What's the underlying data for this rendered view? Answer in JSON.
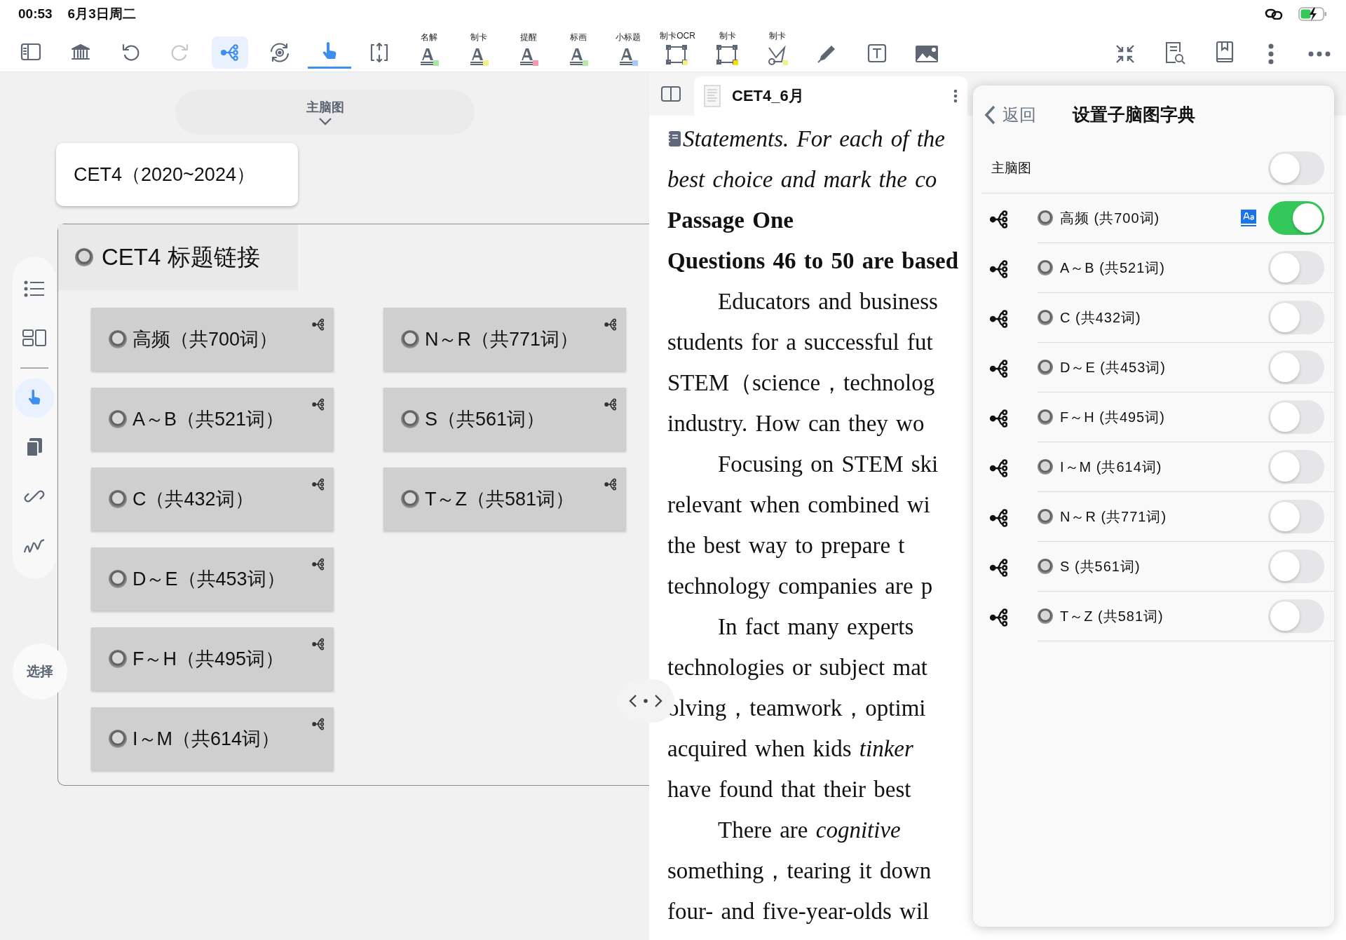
{
  "status_bar": {
    "time": "00:53",
    "date": "6月3日周二"
  },
  "toolbar": {
    "tools": [
      {
        "selected": false,
        "highlighted": false,
        "disabled": false
      },
      {
        "selected": false,
        "highlighted": false,
        "disabled": false
      },
      {
        "selected": false,
        "highlighted": false,
        "disabled": false
      },
      {
        "selected": false,
        "highlighted": false,
        "disabled": true
      },
      {
        "selected": false,
        "highlighted": true,
        "disabled": false
      },
      {
        "selected": false,
        "highlighted": false,
        "disabled": false
      },
      {
        "selected": true,
        "highlighted": false,
        "disabled": false
      },
      {
        "selected": false,
        "highlighted": false,
        "disabled": false
      }
    ],
    "markers": [
      {
        "kind": "text",
        "label": "名解",
        "color": "#a6e8a0"
      },
      {
        "kind": "text",
        "label": "制卡",
        "color": "#f3f08a"
      },
      {
        "kind": "text",
        "label": "提醒",
        "color": "#f29bb0"
      },
      {
        "kind": "text",
        "label": "标画",
        "color": "#b4eaa8"
      },
      {
        "kind": "text",
        "label": "小标题",
        "color": "#a9c9f2"
      },
      {
        "kind": "frame",
        "label": "制卡OCR",
        "color": "#f3f08a"
      },
      {
        "kind": "frame",
        "label": "制卡",
        "color": "#f2e400"
      },
      {
        "kind": "lasso",
        "label": "制卡",
        "color": "#f3f08a"
      }
    ]
  },
  "side_tools": [
    {
      "selected": false
    },
    {
      "selected": false
    },
    {
      "selected": true
    },
    {
      "selected": false
    },
    {
      "selected": false
    },
    {
      "selected": false
    }
  ],
  "select_button": "选择",
  "mindmap": {
    "switcher": "主脑图",
    "root": "CET4（2020~2024）",
    "group": {
      "title": "CET4 标题链接",
      "columns": [
        [
          {
            "label": "高频（共700词）"
          },
          {
            "label": "A～B（共521词）"
          },
          {
            "label": "C（共432词）"
          },
          {
            "label": "D～E（共453词）"
          },
          {
            "label": "F～H（共495词）"
          },
          {
            "label": "I～M（共614词）"
          }
        ],
        [
          {
            "label": "N～R（共771词）"
          },
          {
            "label": "S（共561词）"
          },
          {
            "label": "T～Z（共581词）"
          }
        ]
      ]
    }
  },
  "document": {
    "tab_title": "CET4_6月",
    "lines": [
      {
        "text": "Statements. For each of the",
        "kind": "instruction",
        "indent": false
      },
      {
        "text": "best choice and mark the co",
        "kind": "instruction",
        "indent": false
      },
      {
        "text": "Passage One",
        "kind": "heading",
        "indent": false
      },
      {
        "text": "Questions 46 to 50 are based",
        "kind": "heading",
        "indent": false
      },
      {
        "text": "Educators and business",
        "kind": "body",
        "indent": true
      },
      {
        "text": "students for a successful fut",
        "kind": "body",
        "indent": false
      },
      {
        "text": "STEM（science，technolog",
        "kind": "body",
        "indent": false
      },
      {
        "text": "industry. How can they wo",
        "kind": "body",
        "indent": false
      },
      {
        "text": "Focusing on STEM ski",
        "kind": "body",
        "indent": true
      },
      {
        "text": "relevant when combined wi",
        "kind": "body",
        "indent": false
      },
      {
        "text": "the best way to prepare t",
        "kind": "body",
        "indent": false
      },
      {
        "text": "technology companies are p",
        "kind": "body",
        "indent": false
      },
      {
        "text": "In fact many experts",
        "kind": "body",
        "indent": true
      },
      {
        "text": "technologies or subject mat",
        "kind": "body",
        "indent": false
      },
      {
        "text": "olving，teamwork，optimi",
        "kind": "body",
        "indent": false
      },
      {
        "text": "acquired when kids *tinker*",
        "kind": "body",
        "indent": false
      },
      {
        "text": "have found that their best",
        "kind": "body",
        "indent": false
      },
      {
        "text": "There are *cognitive*",
        "kind": "body",
        "indent": true
      },
      {
        "text": "something，tearing it down",
        "kind": "body",
        "indent": false
      },
      {
        "text": "four- and five-year-olds wil",
        "kind": "body",
        "indent": false
      }
    ]
  },
  "popup": {
    "back": "返回",
    "title": "设置子脑图字典",
    "main": {
      "label": "主脑图",
      "on": false
    },
    "items": [
      {
        "label": "高频 (共700词)",
        "on": true,
        "dictionary": true
      },
      {
        "label": "A～B (共521词)",
        "on": false,
        "dictionary": false
      },
      {
        "label": "C (共432词)",
        "on": false,
        "dictionary": false
      },
      {
        "label": "D～E (共453词)",
        "on": false,
        "dictionary": false
      },
      {
        "label": "F～H (共495词)",
        "on": false,
        "dictionary": false
      },
      {
        "label": "I～M (共614词)",
        "on": false,
        "dictionary": false
      },
      {
        "label": "N～R (共771词)",
        "on": false,
        "dictionary": false
      },
      {
        "label": "S (共561词)",
        "on": false,
        "dictionary": false
      },
      {
        "label": "T～Z (共581词)",
        "on": false,
        "dictionary": false
      }
    ]
  }
}
